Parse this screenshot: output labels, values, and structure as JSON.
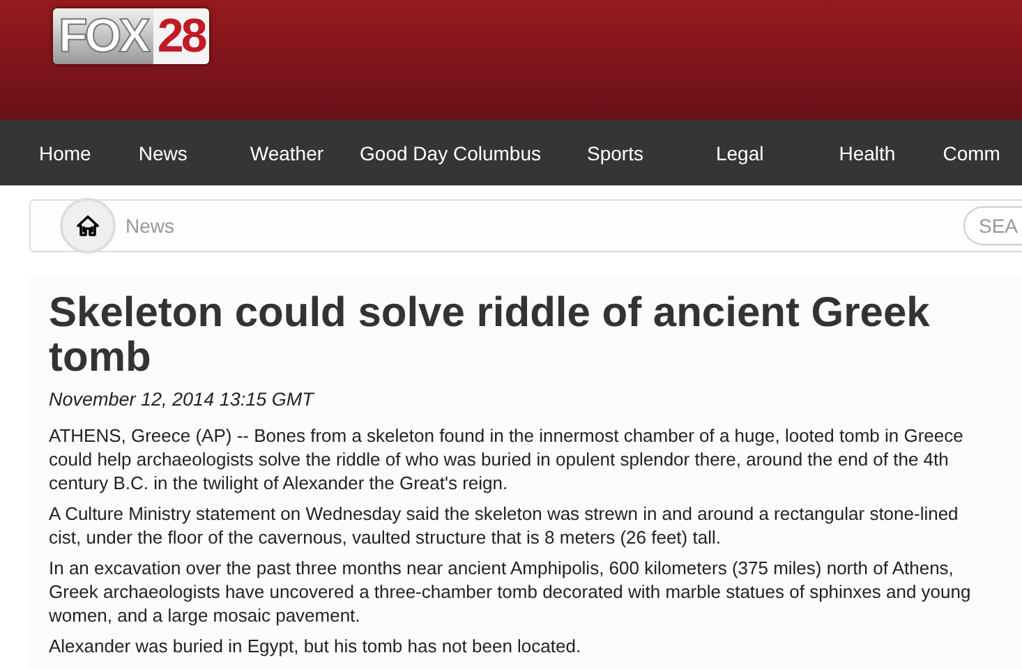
{
  "logo": {
    "name": "FOX",
    "number": "28"
  },
  "nav": [
    {
      "label": "Home"
    },
    {
      "label": "News"
    },
    {
      "label": "Weather"
    },
    {
      "label": "Good Day Columbus"
    },
    {
      "label": "Sports"
    },
    {
      "label": "Legal"
    },
    {
      "label": "Health"
    },
    {
      "label": "Comm"
    }
  ],
  "breadcrumb": {
    "current": "News"
  },
  "search": {
    "placeholder": "SEA"
  },
  "article": {
    "title": "Skeleton could solve riddle of ancient Greek tomb",
    "date": "November 12, 2014 13:15 GMT",
    "paragraphs": [
      "ATHENS, Greece (AP) -- Bones from a skeleton found in the innermost chamber of a huge, looted tomb in Greece could help archaeologists solve the riddle of who was buried in opulent splendor there, around the end of the 4th century B.C. in the twilight of Alexander the Great's reign.",
      "A Culture Ministry statement on Wednesday said the skeleton was strewn in and around a rectangular stone-lined cist, under the floor of the cavernous, vaulted structure that is 8 meters (26 feet) tall.",
      "In an excavation over the past three months near ancient Amphipolis, 600 kilometers (375 miles) north of Athens, Greek archaeologists have uncovered a three-chamber tomb decorated with marble statues of sphinxes and young women, and a large mosaic pavement.",
      "Alexander was buried in Egypt, but his tomb has not been located."
    ]
  }
}
